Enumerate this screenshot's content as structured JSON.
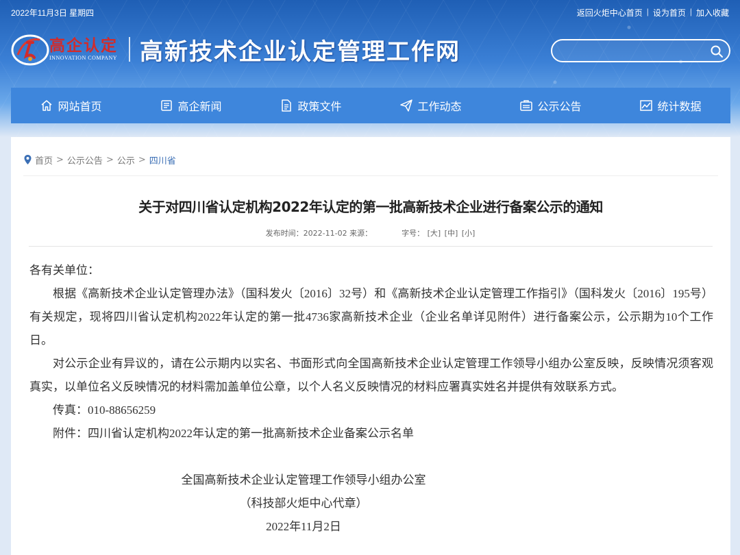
{
  "topbar": {
    "date": "2022年11月3日 星期四",
    "links": [
      "返回火炬中心首页",
      "设为首页",
      "加入收藏"
    ]
  },
  "logo": {
    "cn": "高企认定",
    "en": "INNOVATION COMPANY"
  },
  "site_title": "高新技术企业认定管理工作网",
  "search": {
    "placeholder": "",
    "icon": "search-icon"
  },
  "nav": [
    {
      "label": "网站首页",
      "icon": "home-icon"
    },
    {
      "label": "高企新闻",
      "icon": "news-icon"
    },
    {
      "label": "政策文件",
      "icon": "document-icon"
    },
    {
      "label": "工作动态",
      "icon": "send-icon"
    },
    {
      "label": "公示公告",
      "icon": "notice-icon"
    },
    {
      "label": "统计数据",
      "icon": "chart-icon"
    }
  ],
  "breadcrumb": {
    "items": [
      "首页",
      "公示公告",
      "公示"
    ],
    "current": "四川省",
    "separator": ">"
  },
  "article": {
    "title": "关于对四川省认定机构2022年认定的第一批高新技术企业进行备案公示的通知",
    "meta": {
      "published_label": "发布时间：",
      "published": "2022-11-02",
      "source_label": "来源：",
      "fontsize_label": "字号：",
      "sizes": [
        "[大]",
        "[中]",
        "[小]"
      ]
    },
    "salutation": "各有关单位：",
    "paragraphs": [
      "根据《高新技术企业认定管理办法》（国科发火〔2016〕32号）和《高新技术企业认定管理工作指引》（国科发火〔2016〕195号）有关规定，现将四川省认定机构2022年认定的第一批4736家高新技术企业（企业名单详见附件）进行备案公示，公示期为10个工作日。",
      "对公示企业有异议的，请在公示期内以实名、书面形式向全国高新技术企业认定管理工作领导小组办公室反映，反映情况须客观真实，以单位名义反映情况的材料需加盖单位公章，以个人名义反映情况的材料应署真实姓名并提供有效联系方式。",
      "传真：010-88656259",
      "附件：四川省认定机构2022年认定的第一批高新技术企业备案公示名单"
    ],
    "signature": {
      "org": "全国高新技术企业认定管理工作领导小组办公室",
      "seal": "（科技部火炬中心代章）",
      "date": "2022年11月2日"
    }
  },
  "colors": {
    "header_blue": "#1f5fb5",
    "nav_blue": "#3e86dc",
    "logo_red": "#d12c2c",
    "breadcrumb_current": "#3b6fb5"
  }
}
